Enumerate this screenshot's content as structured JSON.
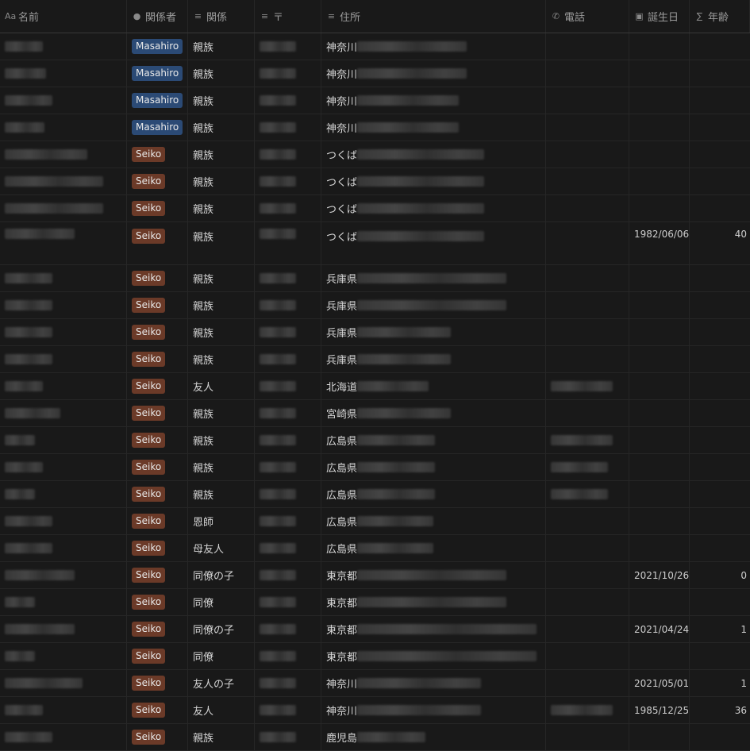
{
  "columns": {
    "name": {
      "icon": "Aa",
      "label": "名前"
    },
    "related": {
      "icon": "●",
      "label": "関係者"
    },
    "relation": {
      "icon": "≡",
      "label": "関係"
    },
    "zip": {
      "icon": "≡",
      "label": "〒"
    },
    "address": {
      "icon": "≡",
      "label": "住所"
    },
    "phone": {
      "icon": "✆",
      "label": "電話"
    },
    "birthday": {
      "icon": "▣",
      "label": "誕生日"
    },
    "age": {
      "icon": "∑",
      "label": "年齢"
    }
  },
  "colors": {
    "masahiro": "#2b4a75",
    "seiko": "#6b3a28",
    "background": "#191919"
  },
  "rows": [
    {
      "related": "Masahiro",
      "relation": "親族",
      "pref": "神奈川",
      "birthday": "",
      "age": "",
      "phone": false
    },
    {
      "related": "Masahiro",
      "relation": "親族",
      "pref": "神奈川",
      "birthday": "",
      "age": "",
      "phone": false
    },
    {
      "related": "Masahiro",
      "relation": "親族",
      "pref": "神奈川",
      "birthday": "",
      "age": "",
      "phone": false
    },
    {
      "related": "Masahiro",
      "relation": "親族",
      "pref": "神奈川",
      "birthday": "",
      "age": "",
      "phone": false
    },
    {
      "related": "Seiko",
      "relation": "親族",
      "pref": "つくば",
      "birthday": "",
      "age": "",
      "phone": false
    },
    {
      "related": "Seiko",
      "relation": "親族",
      "pref": "つくば",
      "birthday": "",
      "age": "",
      "phone": false
    },
    {
      "related": "Seiko",
      "relation": "親族",
      "pref": "つくば",
      "birthday": "",
      "age": "",
      "phone": false
    },
    {
      "related": "Seiko",
      "relation": "親族",
      "pref": "つくば",
      "birthday": "1982/06/06",
      "age": "40",
      "phone": false,
      "tall": true
    },
    {
      "related": "Seiko",
      "relation": "親族",
      "pref": "兵庫県",
      "birthday": "",
      "age": "",
      "phone": false
    },
    {
      "related": "Seiko",
      "relation": "親族",
      "pref": "兵庫県",
      "birthday": "",
      "age": "",
      "phone": false
    },
    {
      "related": "Seiko",
      "relation": "親族",
      "pref": "兵庫県",
      "birthday": "",
      "age": "",
      "phone": false
    },
    {
      "related": "Seiko",
      "relation": "親族",
      "pref": "兵庫県",
      "birthday": "",
      "age": "",
      "phone": false
    },
    {
      "related": "Seiko",
      "relation": "友人",
      "pref": "北海道",
      "birthday": "",
      "age": "",
      "phone": true
    },
    {
      "related": "Seiko",
      "relation": "親族",
      "pref": "宮崎県",
      "birthday": "",
      "age": "",
      "phone": false
    },
    {
      "related": "Seiko",
      "relation": "親族",
      "pref": "広島県",
      "birthday": "",
      "age": "",
      "phone": true
    },
    {
      "related": "Seiko",
      "relation": "親族",
      "pref": "広島県",
      "birthday": "",
      "age": "",
      "phone": true
    },
    {
      "related": "Seiko",
      "relation": "親族",
      "pref": "広島県",
      "birthday": "",
      "age": "",
      "phone": true
    },
    {
      "related": "Seiko",
      "relation": "恩師",
      "pref": "広島県",
      "birthday": "",
      "age": "",
      "phone": false
    },
    {
      "related": "Seiko",
      "relation": "母友人",
      "pref": "広島県",
      "birthday": "",
      "age": "",
      "phone": false
    },
    {
      "related": "Seiko",
      "relation": "同僚の子",
      "pref": "東京都",
      "birthday": "2021/10/26",
      "age": "0",
      "phone": false
    },
    {
      "related": "Seiko",
      "relation": "同僚",
      "pref": "東京都",
      "birthday": "",
      "age": "",
      "phone": false
    },
    {
      "related": "Seiko",
      "relation": "同僚の子",
      "pref": "東京都",
      "birthday": "2021/04/24",
      "age": "1",
      "phone": false
    },
    {
      "related": "Seiko",
      "relation": "同僚",
      "pref": "東京都",
      "birthday": "",
      "age": "",
      "phone": false
    },
    {
      "related": "Seiko",
      "relation": "友人の子",
      "pref": "神奈川",
      "birthday": "2021/05/01",
      "age": "1",
      "phone": false
    },
    {
      "related": "Seiko",
      "relation": "友人",
      "pref": "神奈川",
      "birthday": "1985/12/25",
      "age": "36",
      "phone": true
    },
    {
      "related": "Seiko",
      "relation": "親族",
      "pref": "鹿児島",
      "birthday": "",
      "age": "",
      "phone": false
    }
  ]
}
